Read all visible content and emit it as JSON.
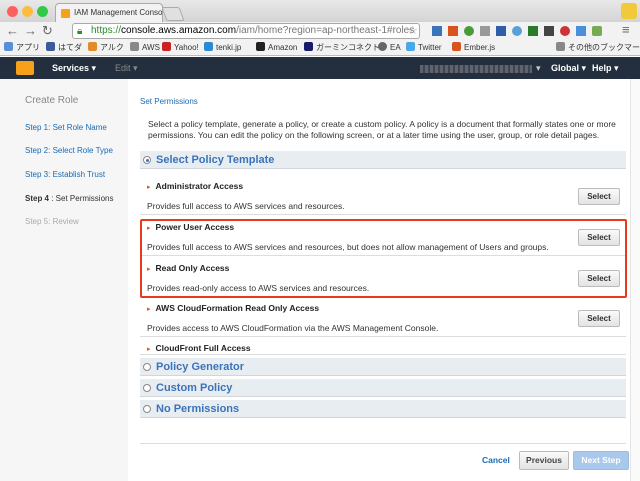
{
  "browser": {
    "tab_title": "IAM Management Console",
    "url_scheme": "https://",
    "url_host": "console.aws.amazon.com",
    "url_rest": "/iam/home?region=ap-northeast-1#roles",
    "bookmarks": [
      "アプリ",
      "はてダ",
      "アルク",
      "AWS",
      "Yahoo!",
      "tenki.jp",
      "Amazon",
      "ガーミンコネクト",
      "EA",
      "Twitter",
      "Ember.js"
    ],
    "other_bookmarks": "その他のブックマーク"
  },
  "aws_nav": {
    "services": "Services",
    "edit": "Edit",
    "region": "Global",
    "help": "Help"
  },
  "sidebar": {
    "title": "Create Role",
    "steps": [
      {
        "label": "Step 1: Set Role Name"
      },
      {
        "label": "Step 2: Select Role Type"
      },
      {
        "label": "Step 3: Establish Trust"
      },
      {
        "label_prefix": "Step 4",
        "label_rest": " : Set Permissions"
      },
      {
        "label": "Step 5: Review"
      }
    ]
  },
  "main": {
    "breadcrumb": "Set Permissions",
    "description": "Select a policy template, generate a policy, or create a custom policy. A policy is a document that formally states one or more permissions. You can edit the policy on the following screen, or at a later time using the user, group, or role detail pages.",
    "sections": [
      {
        "label": "Select Policy Template",
        "selected": true
      },
      {
        "label": "Policy Generator",
        "selected": false
      },
      {
        "label": "Custom Policy",
        "selected": false
      },
      {
        "label": "No Permissions",
        "selected": false
      }
    ],
    "select_label": "Select",
    "policies": [
      {
        "name": "Administrator Access",
        "desc": "Provides full access to AWS services and resources."
      },
      {
        "name": "Power User Access",
        "desc": "Provides full access to AWS services and resources, but does not allow management of Users and groups."
      },
      {
        "name": "Read Only Access",
        "desc": "Provides read-only access to AWS services and resources."
      },
      {
        "name": "AWS CloudFormation Read Only Access",
        "desc": "Provides access to AWS CloudFormation via the AWS Management Console."
      },
      {
        "name": "CloudFront Full Access",
        "desc": ""
      }
    ]
  },
  "footer": {
    "cancel": "Cancel",
    "previous": "Previous",
    "next": "Next Step"
  },
  "colors": {
    "aws_bar": "#232f3e",
    "link": "#1a6ab5",
    "highlight": "#e8391c"
  }
}
